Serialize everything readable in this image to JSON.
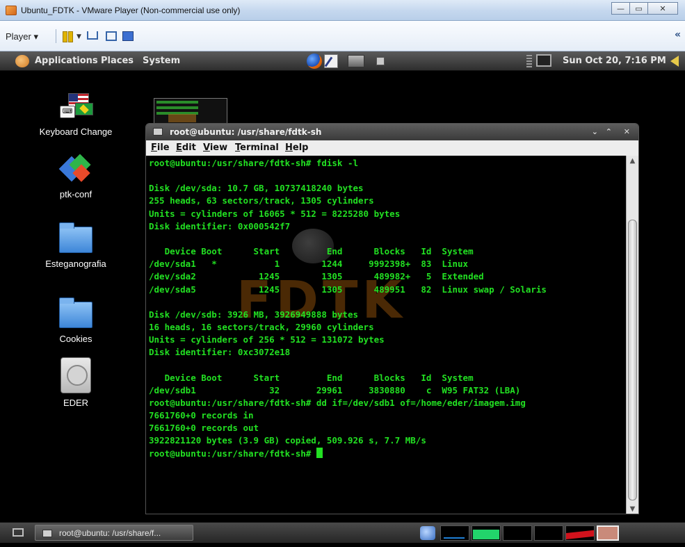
{
  "vmware": {
    "title": "Ubuntu_FDTK - VMware Player (Non-commercial use only)",
    "player_menu": "Player ▾",
    "controls": {
      "minimize": "—",
      "maximize": "▭",
      "close": "✕"
    },
    "collapse": "«"
  },
  "panel": {
    "menus": [
      "Applications",
      "Places",
      "System"
    ],
    "clock": "Sun Oct 20,  7:16 PM"
  },
  "desktop_icons": [
    {
      "label": "Keyboard Change",
      "icon": "keyboard-flags-icon"
    },
    {
      "label": "ptk-conf",
      "icon": "ptk-icon"
    },
    {
      "label": "Esteganografia",
      "icon": "folder-icon"
    },
    {
      "label": "Cookies",
      "icon": "folder-icon"
    },
    {
      "label": "EDER",
      "icon": "hard-drive-icon"
    }
  ],
  "terminal": {
    "title": "root@ubuntu: /usr/share/fdtk-sh",
    "menu": {
      "file": {
        "key": "F",
        "rest": "ile"
      },
      "edit": {
        "key": "E",
        "rest": "dit"
      },
      "view": {
        "key": "V",
        "rest": "iew"
      },
      "terminal": {
        "key": "T",
        "rest": "erminal"
      },
      "help": {
        "key": "H",
        "rest": "elp"
      }
    },
    "lines": [
      "root@ubuntu:/usr/share/fdtk-sh# fdisk -l",
      "",
      "Disk /dev/sda: 10.7 GB, 10737418240 bytes",
      "255 heads, 63 sectors/track, 1305 cylinders",
      "Units = cylinders of 16065 * 512 = 8225280 bytes",
      "Disk identifier: 0x000542f7",
      "",
      "   Device Boot      Start         End      Blocks   Id  System",
      "/dev/sda1   *           1        1244     9992398+  83  Linux",
      "/dev/sda2            1245        1305      489982+   5  Extended",
      "/dev/sda5            1245        1305      489951   82  Linux swap / Solaris",
      "",
      "Disk /dev/sdb: 3926 MB, 3926949888 bytes",
      "16 heads, 16 sectors/track, 29960 cylinders",
      "Units = cylinders of 256 * 512 = 131072 bytes",
      "Disk identifier: 0xc3072e18",
      "",
      "   Device Boot      Start         End      Blocks   Id  System",
      "/dev/sdb1              32       29961     3830880    c  W95 FAT32 (LBA)",
      "root@ubuntu:/usr/share/fdtk-sh# dd if=/dev/sdb1 of=/home/eder/imagem.img",
      "7661760+0 records in",
      "7661760+0 records out",
      "3922821120 bytes (3.9 GB) copied, 509.926 s, 7.7 MB/s"
    ],
    "prompt": "root@ubuntu:/usr/share/fdtk-sh# ",
    "watermark_text": "FDTK"
  },
  "taskbar": {
    "window_button": "root@ubuntu: /usr/share/f..."
  },
  "colors": {
    "terminal_text": "#22e022",
    "watermark": "#e07d12",
    "mem_monitor": "#22d46b",
    "load_monitor": "#d0121c"
  },
  "monitors": {
    "memory_fill": 0.7,
    "load_fill": 0.45
  }
}
